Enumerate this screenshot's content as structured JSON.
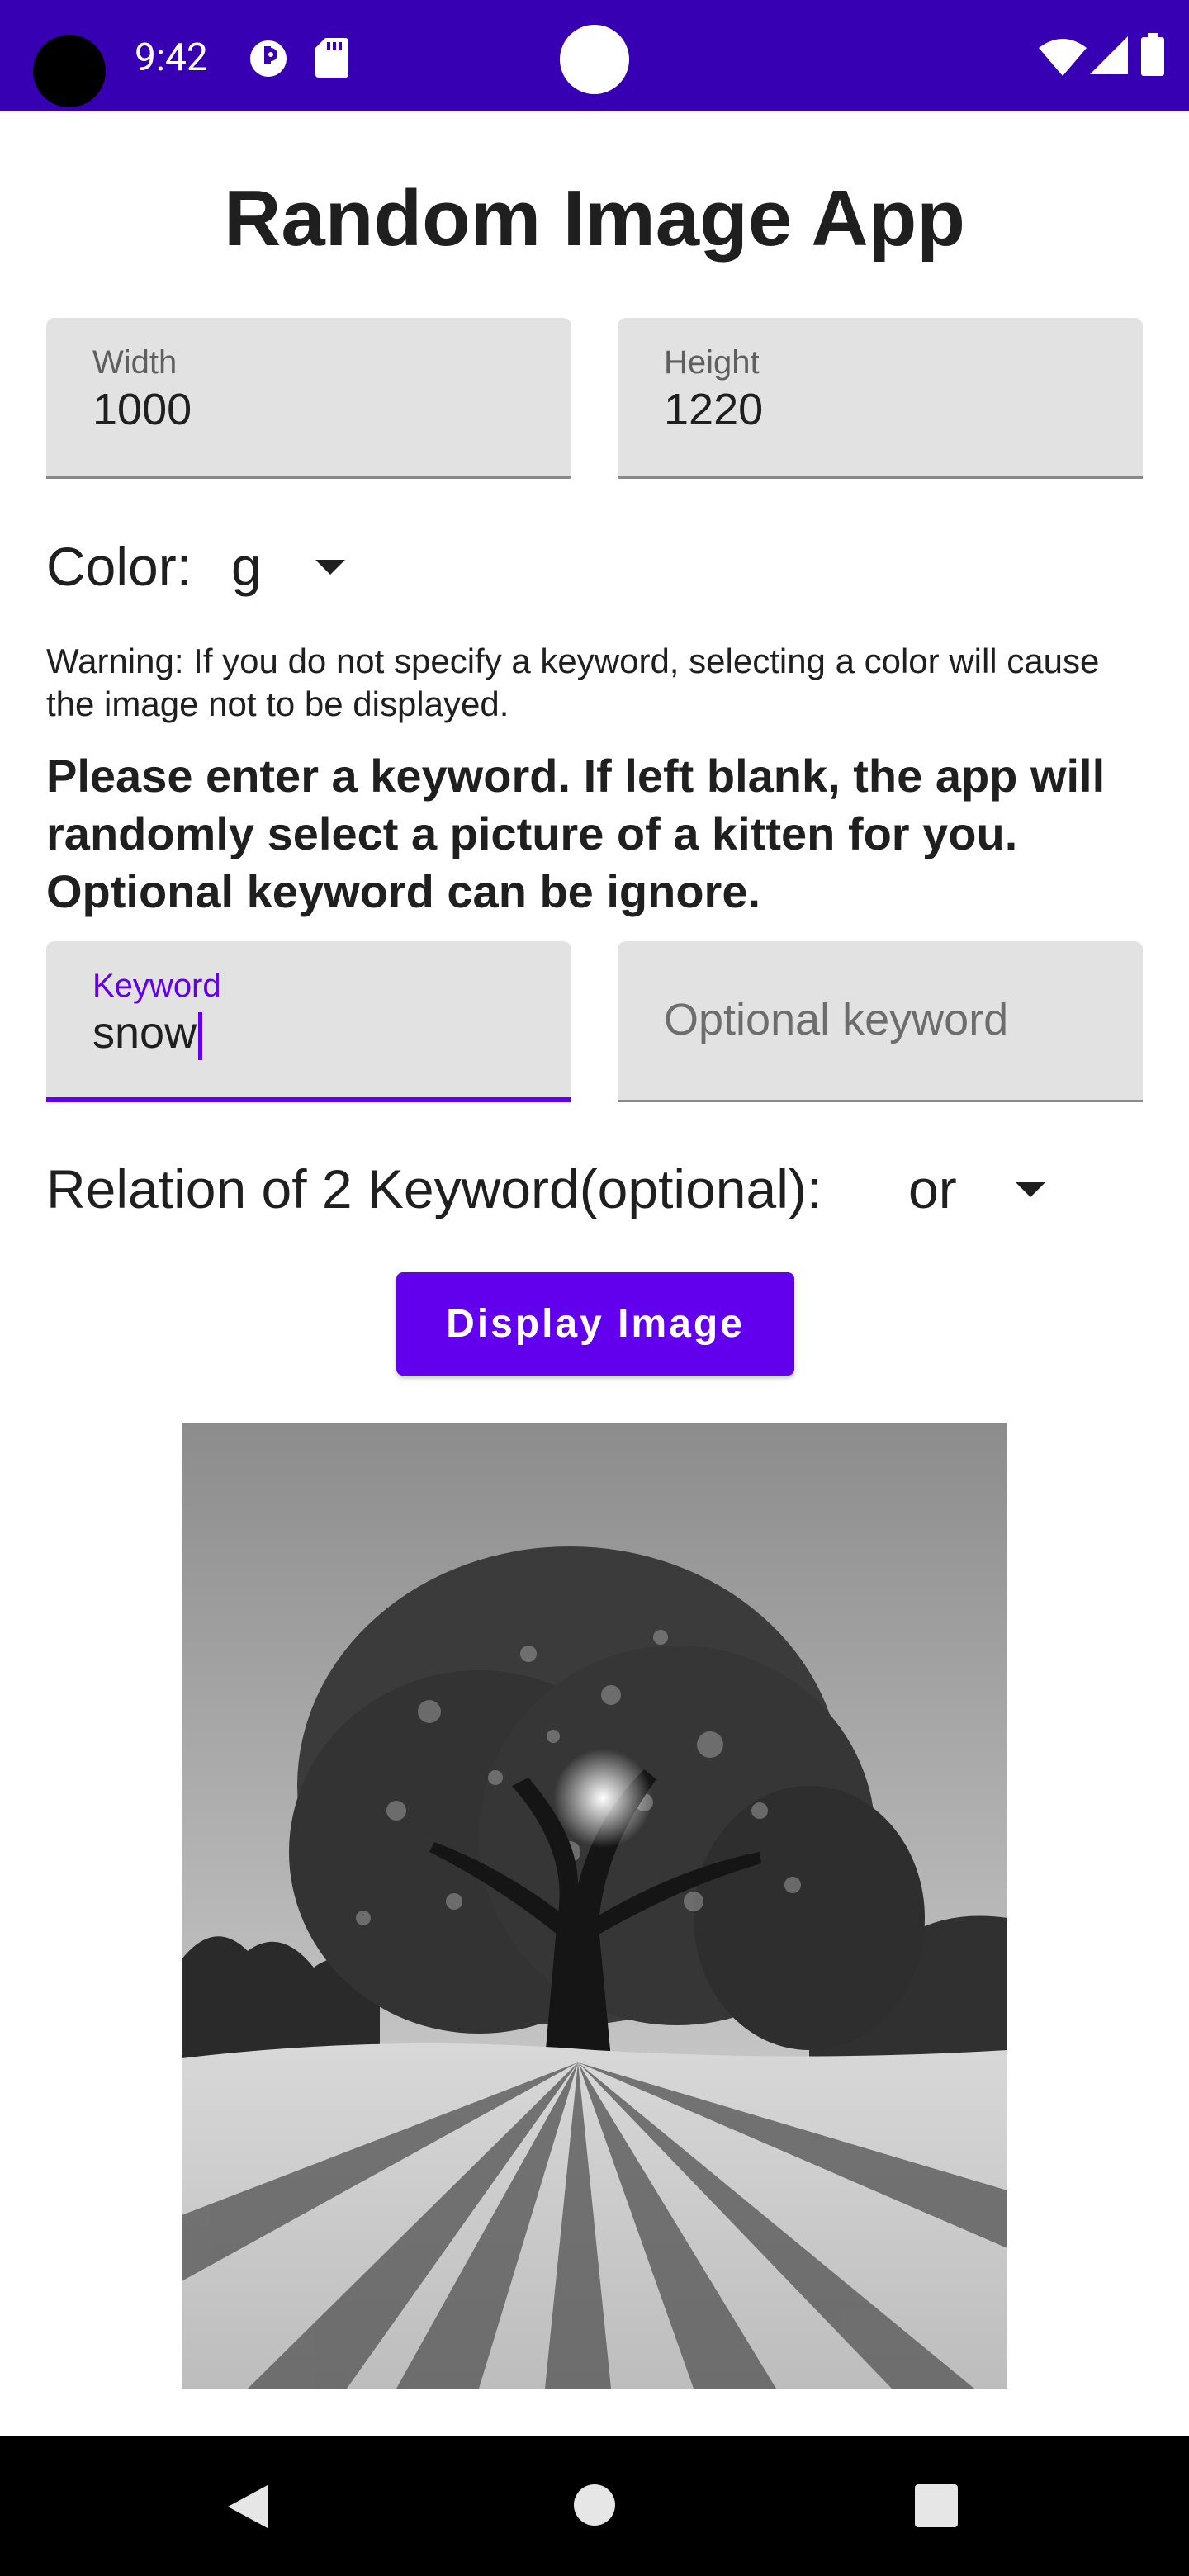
{
  "status_bar": {
    "time": "9:42",
    "icons": [
      "camera-punch-hole",
      "data-saver-icon",
      "sd-card-icon",
      "wifi-icon",
      "signal-icon",
      "battery-icon"
    ]
  },
  "app": {
    "title": "Random Image App",
    "width_field": {
      "label": "Width",
      "value": "1000"
    },
    "height_field": {
      "label": "Height",
      "value": "1220"
    },
    "color": {
      "label": "Color:",
      "selected": "g"
    },
    "warning": "Warning: If you do not specify a keyword, selecting a color will cause the image not to be displayed.",
    "prompt": "Please enter a keyword. If left blank, the app will randomly select a picture of a kitten for you. Optional keyword can be ignore.",
    "keyword_field": {
      "label": "Keyword",
      "value": "snow"
    },
    "optional_keyword_field": {
      "placeholder": "Optional keyword"
    },
    "relation": {
      "label": "Relation of 2 Keyword(optional):",
      "selected": "or"
    },
    "display_button": "Display Image",
    "image": {
      "description": "grayscale-snow-tree-photo"
    }
  },
  "colors": {
    "status_bar": "#3700b3",
    "accent": "#6200ee",
    "field_bg": "#e2e2e2"
  }
}
